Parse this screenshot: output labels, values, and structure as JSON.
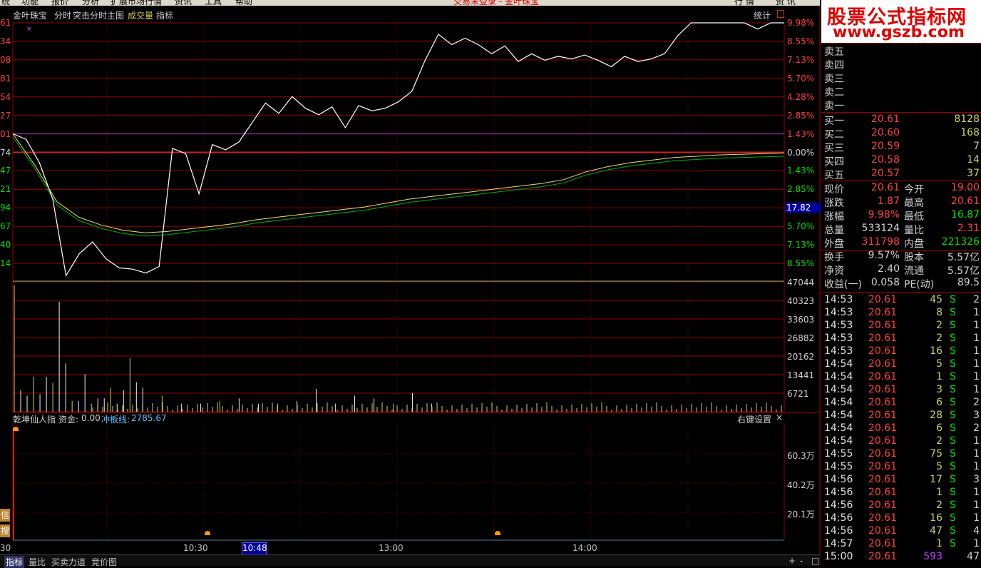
{
  "menubar": {
    "items": [
      "统",
      "功能",
      "报价",
      "分析",
      "扩展市场行情",
      "资讯",
      "工具",
      "帮助"
    ],
    "center": "交易未登录 - 金叶珠宝",
    "right": [
      "行 情",
      "资 讯"
    ]
  },
  "watermark": {
    "cn": "股票公式指标网",
    "url": "www.gszb.com"
  },
  "chart_header": {
    "stock": "金叶珠宝",
    "mode": "分时",
    "hint": "突击分时主图",
    "vol": "成交量",
    "ind": "指标",
    "stat": "统计"
  },
  "price_axis": {
    "left": [
      "61",
      "34",
      "08",
      "81",
      "54",
      "27",
      "01",
      "74",
      "47",
      "21",
      "94",
      "67",
      "40",
      "14"
    ],
    "right": [
      "9.98%",
      "8.55%",
      "7.13%",
      "5.70%",
      "4.28%",
      "2.85%",
      "1.43%",
      "0.00%",
      "1.43%",
      "2.85%",
      "17.82",
      "5.70%",
      "7.13%",
      "8.55%"
    ]
  },
  "volume_axis": [
    "47044",
    "40323",
    "33603",
    "26882",
    "20162",
    "13441",
    "6721"
  ],
  "indicator": {
    "name": "乾坤仙人指",
    "fund_label": "资金:",
    "fund_value": "0.00",
    "line_label": "冲板线:",
    "line_value": "2785.67",
    "settings": "右键设置",
    "close": "×",
    "axis": [
      "60.3万",
      "40.2万",
      "20.1万"
    ]
  },
  "time_axis": [
    "30",
    "10:30",
    "10:48",
    "13:00",
    "14:00"
  ],
  "side_buttons": [
    "信",
    "搜"
  ],
  "bottom_tabs": [
    "指标",
    "量比",
    "买卖力道",
    "竞价图"
  ],
  "bottom_right": [
    "+",
    "-",
    "□"
  ],
  "order_book": {
    "sell": [
      "卖五",
      "卖四",
      "卖三",
      "卖二",
      "卖一"
    ],
    "buy": [
      {
        "label": "买一",
        "price": "20.61",
        "vol": "8128"
      },
      {
        "label": "买二",
        "price": "20.60",
        "vol": "168"
      },
      {
        "label": "买三",
        "price": "20.59",
        "vol": "7"
      },
      {
        "label": "买四",
        "price": "20.58",
        "vol": "14"
      },
      {
        "label": "买五",
        "price": "20.57",
        "vol": "37"
      }
    ]
  },
  "quote": [
    {
      "l1": "现价",
      "v1": "20.61",
      "l2": "今开",
      "v2": "19.00",
      "c1": "#ff4040",
      "c2": "#ff4040"
    },
    {
      "l1": "涨跌",
      "v1": "1.87",
      "l2": "最高",
      "v2": "20.61",
      "c1": "#ff4040",
      "c2": "#ff4040"
    },
    {
      "l1": "涨幅",
      "v1": "9.98%",
      "l2": "最低",
      "v2": "16.87",
      "c1": "#ff4040",
      "c2": "#00e000"
    },
    {
      "l1": "总量",
      "v1": "533124",
      "l2": "量比",
      "v2": "2.31",
      "c1": "#d0d0d0",
      "c2": "#ff4040"
    },
    {
      "l1": "外盘",
      "v1": "311798",
      "l2": "内盘",
      "v2": "221326",
      "c1": "#ff4040",
      "c2": "#00e000"
    },
    {
      "l1": "换手",
      "v1": "9.57%",
      "l2": "股本",
      "v2": "5.57亿",
      "c1": "#d0d0d0",
      "c2": "#d0d0d0"
    },
    {
      "l1": "净资",
      "v1": "2.40",
      "l2": "流通",
      "v2": "5.57亿",
      "c1": "#d0d0d0",
      "c2": "#d0d0d0"
    },
    {
      "l1": "收益(一)",
      "v1": "0.058",
      "l2": "PE(动)",
      "v2": "89.5",
      "c1": "#d0d0d0",
      "c2": "#d0d0d0"
    }
  ],
  "ticks": [
    {
      "t": "14:53",
      "p": "20.61",
      "v": "45",
      "s": "S",
      "n": "2"
    },
    {
      "t": "14:53",
      "p": "20.61",
      "v": "8",
      "s": "S",
      "n": "1"
    },
    {
      "t": "14:53",
      "p": "20.61",
      "v": "2",
      "s": "S",
      "n": "1"
    },
    {
      "t": "14:53",
      "p": "20.61",
      "v": "2",
      "s": "S",
      "n": "1"
    },
    {
      "t": "14:53",
      "p": "20.61",
      "v": "16",
      "s": "S",
      "n": "1"
    },
    {
      "t": "14:54",
      "p": "20.61",
      "v": "5",
      "s": "S",
      "n": "1"
    },
    {
      "t": "14:54",
      "p": "20.61",
      "v": "1",
      "s": "S",
      "n": "1"
    },
    {
      "t": "14:54",
      "p": "20.61",
      "v": "3",
      "s": "S",
      "n": "1"
    },
    {
      "t": "14:54",
      "p": "20.61",
      "v": "6",
      "s": "S",
      "n": "2"
    },
    {
      "t": "14:54",
      "p": "20.61",
      "v": "28",
      "s": "S",
      "n": "3"
    },
    {
      "t": "14:54",
      "p": "20.61",
      "v": "6",
      "s": "S",
      "n": "2"
    },
    {
      "t": "14:54",
      "p": "20.61",
      "v": "2",
      "s": "S",
      "n": "1"
    },
    {
      "t": "14:55",
      "p": "20.61",
      "v": "75",
      "s": "S",
      "n": "1"
    },
    {
      "t": "14:55",
      "p": "20.61",
      "v": "5",
      "s": "S",
      "n": "1"
    },
    {
      "t": "14:56",
      "p": "20.61",
      "v": "17",
      "s": "S",
      "n": "3"
    },
    {
      "t": "14:56",
      "p": "20.61",
      "v": "1",
      "s": "S",
      "n": "1"
    },
    {
      "t": "14:56",
      "p": "20.61",
      "v": "2",
      "s": "S",
      "n": "1"
    },
    {
      "t": "14:56",
      "p": "20.61",
      "v": "16",
      "s": "S",
      "n": "1"
    },
    {
      "t": "14:56",
      "p": "20.61",
      "v": "47",
      "s": "S",
      "n": "4"
    },
    {
      "t": "14:57",
      "p": "20.61",
      "v": "1",
      "s": "S",
      "n": "1"
    },
    {
      "t": "15:00",
      "p": "20.61",
      "v": "593",
      "s": "",
      "n": "47"
    }
  ],
  "chart_data": {
    "type": "line",
    "title": "",
    "price_line": [
      1.43,
      1.0,
      -0.8,
      -3.6,
      -9.5,
      -7.8,
      -6.9,
      -8.2,
      -8.9,
      -9.0,
      -9.3,
      -8.8,
      0.3,
      -0.1,
      -3.2,
      0.6,
      0.2,
      0.8,
      2.3,
      3.8,
      3.0,
      4.3,
      3.4,
      2.9,
      3.5,
      1.9,
      3.6,
      3.2,
      3.4,
      3.9,
      4.7,
      7.1,
      9.1,
      8.3,
      8.8,
      8.3,
      7.6,
      8.2,
      7.0,
      7.6,
      7.1,
      7.4,
      7.2,
      7.5,
      7.1,
      6.6,
      7.4,
      7.0,
      7.2,
      7.6,
      9.0,
      9.98,
      9.98,
      9.98,
      9.98,
      9.98,
      9.5,
      9.98,
      9.98
    ],
    "avg_line": [
      1.43,
      -1.0,
      -3.8,
      -5.0,
      -5.6,
      -6.0,
      -6.2,
      -6.1,
      -5.9,
      -5.7,
      -5.5,
      -5.2,
      -5.0,
      -4.8,
      -4.6,
      -4.4,
      -4.2,
      -3.9,
      -3.6,
      -3.4,
      -3.2,
      -3.0,
      -2.8,
      -2.6,
      -2.4,
      -2.1,
      -1.5,
      -1.1,
      -0.8,
      -0.6,
      -0.4,
      -0.3,
      -0.2,
      -0.15,
      -0.1,
      -0.05
    ],
    "volume": [
      47044,
      8000,
      6000,
      13000,
      6500,
      13000,
      10800,
      41000,
      18000,
      4000,
      4000,
      14000,
      3000,
      5000,
      5000,
      9000,
      3000,
      8000,
      20000,
      11000,
      9000,
      6000,
      3000,
      3000,
      4000,
      5000,
      3000,
      3000,
      4000,
      8500,
      3000,
      6000,
      5000,
      3000,
      7000,
      3000
    ],
    "ylim_pct": [
      -9.98,
      9.98
    ],
    "vol_ylim": [
      0,
      47044
    ],
    "x_ticks": [
      "30",
      "10:30",
      "10:48",
      "13:00",
      "14:00"
    ]
  }
}
